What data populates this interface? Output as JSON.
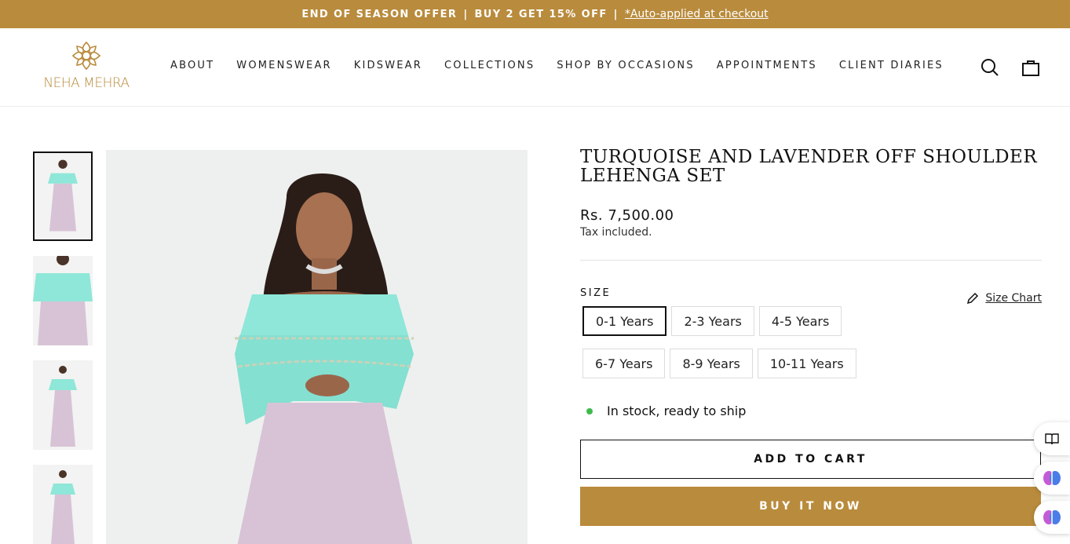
{
  "announcement": {
    "offer_text": "END OF SEASON OFFER",
    "separator": "|",
    "deal_text": "BUY 2 GET 15% OFF",
    "link_text": "*Auto-applied at checkout"
  },
  "header": {
    "brand": "NEHA MEHRA",
    "nav": [
      "ABOUT",
      "WOMENSWEAR",
      "KIDSWEAR",
      "COLLECTIONS",
      "SHOP BY OCCASIONS",
      "APPOINTMENTS",
      "CLIENT DIARIES"
    ],
    "icons": [
      "search-icon",
      "bag-icon"
    ]
  },
  "product": {
    "title": "TURQUOISE AND LAVENDER OFF SHOULDER LEHENGA SET",
    "price": "Rs. 7,500.00",
    "tax_note": "Tax included.",
    "size_label": "SIZE",
    "size_chart_label": "Size Chart",
    "sizes": [
      "0-1 Years",
      "2-3 Years",
      "4-5 Years",
      "6-7 Years",
      "8-9 Years",
      "10-11 Years"
    ],
    "selected_size": "0-1 Years",
    "stock_text": "In stock, ready to ship",
    "add_to_cart": "ADD TO CART",
    "buy_now": "BUY IT NOW"
  },
  "colors": {
    "accent": "#b98b3c",
    "in_stock": "#3dbb4a",
    "top": "#8ee7d8",
    "skirt": "#d8c3d6"
  }
}
